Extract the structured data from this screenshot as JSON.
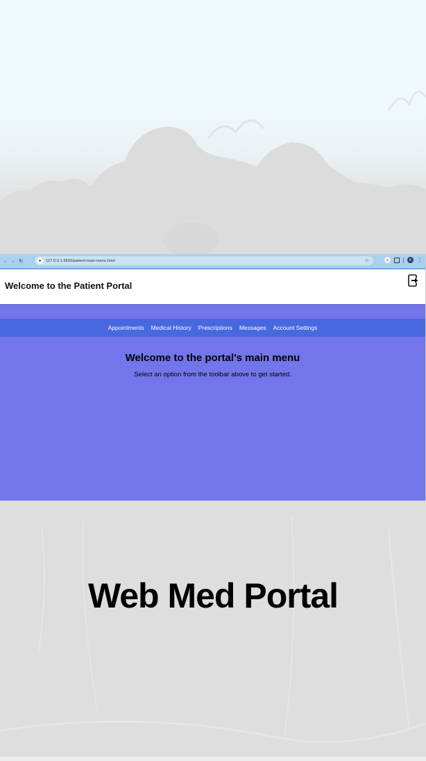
{
  "browser": {
    "url": "127.0.0.1:5500/patient-main-menu.html",
    "profile_initial": "K"
  },
  "header": {
    "title": "Welcome to the Patient Portal"
  },
  "toolbar": {
    "items": [
      "Appointments",
      "Medical History",
      "Prescriptions",
      "Messages",
      "Account Settings"
    ]
  },
  "main": {
    "heading": "Welcome to the portal's main menu",
    "subtext": "Select an option from the toolbar above to get started."
  },
  "banner": {
    "title": "Web Med Portal"
  },
  "colors": {
    "page_bg": "#7375ea",
    "toolbar_bg": "#4868df",
    "header_bg": "#ffffff",
    "browser_bar": "#a9d0ef"
  },
  "icons": {
    "logout": "logout-icon",
    "back": "back-arrow-icon",
    "forward": "forward-arrow-icon",
    "reload": "reload-icon",
    "bookmark": "star-icon"
  }
}
